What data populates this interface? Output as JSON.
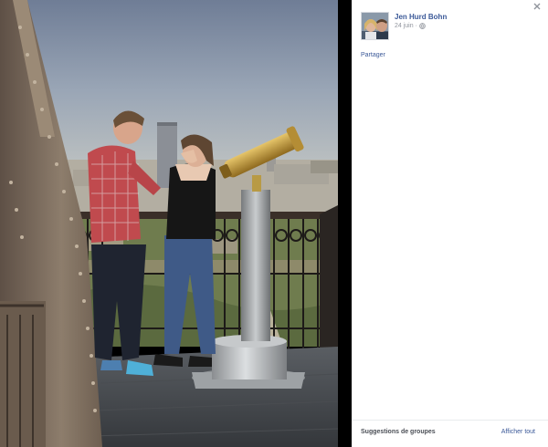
{
  "post": {
    "author": "Jen Hurd Bohn",
    "date": "24 juin",
    "separator": "·",
    "privacy_icon": "globe-icon"
  },
  "actions": {
    "share_label": "Partager"
  },
  "footer": {
    "suggestions_label": "Suggestions de groupes",
    "show_all_label": "Afficher tout"
  },
  "icons": {
    "close": "close-icon"
  },
  "colors": {
    "link": "#3b5998",
    "muted_text": "#90949c",
    "viewer_background": "#000000",
    "panel_background": "#ffffff"
  }
}
